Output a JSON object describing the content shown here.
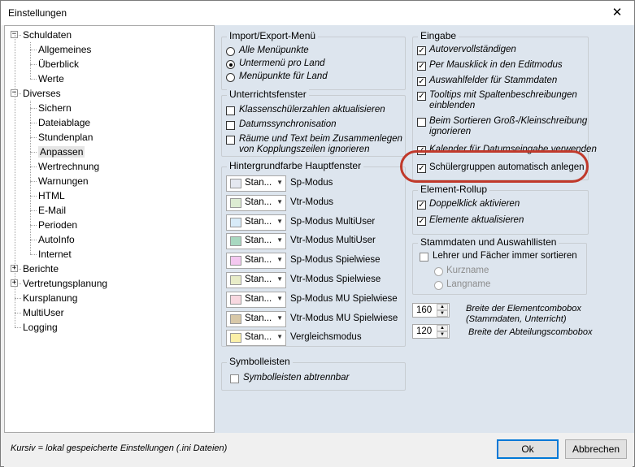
{
  "window": {
    "title": "Einstellungen",
    "close_glyph": "✕"
  },
  "tree": {
    "items": [
      {
        "label": "Schuldaten",
        "expander": "−"
      },
      {
        "label": "Allgemeines"
      },
      {
        "label": "Überblick"
      },
      {
        "label": "Werte"
      },
      {
        "label": "Diverses",
        "expander": "−"
      },
      {
        "label": "Sichern"
      },
      {
        "label": "Dateiablage"
      },
      {
        "label": "Stundenplan"
      },
      {
        "label": "Anpassen",
        "selected": true
      },
      {
        "label": "Wertrechnung"
      },
      {
        "label": "Warnungen"
      },
      {
        "label": "HTML"
      },
      {
        "label": "E-Mail"
      },
      {
        "label": "Perioden"
      },
      {
        "label": "AutoInfo"
      },
      {
        "label": "Internet"
      },
      {
        "label": "Berichte",
        "expander": "+"
      },
      {
        "label": "Vertretungsplanung",
        "expander": "+"
      },
      {
        "label": "Kursplanung"
      },
      {
        "label": "MultiUser"
      },
      {
        "label": "Logging"
      }
    ]
  },
  "import_export": {
    "title": "Import/Export-Menü",
    "options": [
      "Alle Menüpunkte",
      "Untermenü pro Land",
      "Menüpunkte für Land"
    ]
  },
  "lesson_window": {
    "title": "Unterrichtsfenster",
    "options": [
      "Klassenschülerzahlen aktualisieren",
      "Datumssynchronisation",
      "Räume und Text beim Zusammenlegen",
      "von Kopplungszeilen ignorieren"
    ]
  },
  "background": {
    "title": "Hintergrundfarbe Hauptfenster",
    "combo_text": "Stan...",
    "rows": [
      {
        "label": "Sp-Modus",
        "color": "#e4e8f0"
      },
      {
        "label": "Vtr-Modus",
        "color": "#dcebd2"
      },
      {
        "label": "Sp-Modus MultiUser",
        "color": "#d8ebf8"
      },
      {
        "label": "Vtr-Modus MultiUser",
        "color": "#a8d8c0"
      },
      {
        "label": "Sp-Modus Spielwiese",
        "color": "#f4c8f0"
      },
      {
        "label": "Vtr-Modus Spielwiese",
        "color": "#e8ecc8"
      },
      {
        "label": "Sp-Modus MU Spielwiese",
        "color": "#f8d8e0"
      },
      {
        "label": "Vtr-Modus MU Spielwiese",
        "color": "#d8c8a8"
      },
      {
        "label": "Vergleichsmodus",
        "color": "#fbf0a8"
      }
    ]
  },
  "symbol_bars": {
    "title": "Symbolleisten",
    "option": "Symbolleisten abtrennbar"
  },
  "input": {
    "title": "Eingabe",
    "options": [
      "Autovervollständigen",
      "Per Mausklick in den Editmodus",
      "Auswahlfelder für Stammdaten",
      "Tooltips mit Spaltenbeschreibungen",
      "einblenden",
      "Beim Sortieren Groß-/Kleinschreibung",
      "ignorieren",
      "Kalender für Datumseingabe verwenden",
      "Schülergruppen automatisch anlegen"
    ]
  },
  "element_rollup": {
    "title": "Element-Rollup",
    "options": [
      "Doppelklick aktivieren",
      "Elemente aktualisieren"
    ]
  },
  "master_data": {
    "title": "Stammdaten und Auswahllisten",
    "option": "Lehrer und Fächer immer sortieren",
    "radios": [
      "Kurzname",
      "Langname"
    ]
  },
  "combobox_width": {
    "element_value": "160",
    "element_label_1": "Breite der Elementcombobox",
    "element_label_2": "(Stammdaten, Unterricht)",
    "dept_value": "120",
    "dept_label": "Breite der Abteilungscombobox"
  },
  "status": {
    "text": "Kursiv = lokal gespeicherte Einstellungen (.ini Dateien)"
  },
  "buttons": {
    "ok": "Ok",
    "cancel": "Abbrechen"
  },
  "colors": {
    "highlight_ring": "#c0392b",
    "content_bg": "#dde5ee"
  }
}
